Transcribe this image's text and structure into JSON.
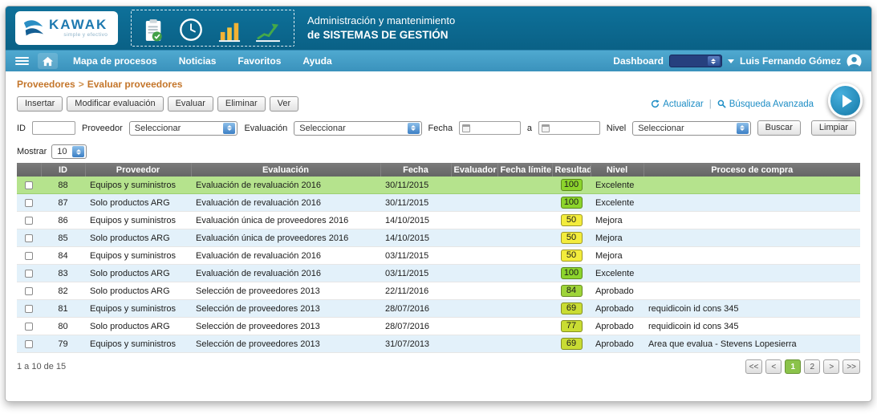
{
  "header": {
    "brand": "KAWAK",
    "tagline": "simple y efectivo",
    "title_line1": "Administración y mantenimiento",
    "title_line2": "de SISTEMAS DE GESTIÓN"
  },
  "nav": {
    "items": [
      "Mapa de procesos",
      "Noticias",
      "Favoritos",
      "Ayuda"
    ],
    "dashboard_label": "Dashboard",
    "dashboard_value": "",
    "user_name": "Luis Fernando Gómez"
  },
  "breadcrumb": {
    "parent": "Proveedores",
    "separator": ">",
    "current": "Evaluar proveedores"
  },
  "toolbar": {
    "buttons": [
      "Insertar",
      "Modificar evaluación",
      "Evaluar",
      "Eliminar",
      "Ver"
    ],
    "refresh_label": "Actualizar",
    "separator": "|",
    "advanced_search_label": "Búsqueda Avanzada"
  },
  "filters": {
    "id_label": "ID",
    "id_value": "",
    "proveedor_label": "Proveedor",
    "evaluacion_label": "Evaluación",
    "fecha_label": "Fecha",
    "fecha_desde": "",
    "fecha_conjunction": "a",
    "fecha_hasta": "",
    "nivel_label": "Nivel",
    "select_value": "Seleccionar",
    "buscar_label": "Buscar",
    "limpiar_label": "Limpiar"
  },
  "list": {
    "mostrar_label": "Mostrar",
    "page_size": "10"
  },
  "table": {
    "headers": [
      "ID",
      "Proveedor",
      "Evaluación",
      "Fecha",
      "Evaluador",
      "Fecha límite",
      "Resultado",
      "Nivel",
      "Proceso de compra"
    ],
    "rows": [
      {
        "id": "88",
        "proveedor": "Equipos y suministros",
        "evaluacion": "Evaluación de revaluación 2016",
        "fecha": "30/11/2015",
        "evaluador": "",
        "fecha_limite": "",
        "resultado": "100",
        "badge_color": "#8CD42C",
        "nivel": "Excelente",
        "proceso_compra": ""
      },
      {
        "id": "87",
        "proveedor": "Solo productos ARG",
        "evaluacion": "Evaluación de revaluación 2016",
        "fecha": "30/11/2015",
        "evaluador": "",
        "fecha_limite": "",
        "resultado": "100",
        "badge_color": "#8CD42C",
        "nivel": "Excelente",
        "proceso_compra": ""
      },
      {
        "id": "86",
        "proveedor": "Equipos y suministros",
        "evaluacion": "Evaluación única de proveedores 2016",
        "fecha": "14/10/2015",
        "evaluador": "",
        "fecha_limite": "",
        "resultado": "50",
        "badge_color": "#F3EC3C",
        "nivel": "Mejora",
        "proceso_compra": ""
      },
      {
        "id": "85",
        "proveedor": "Solo productos ARG",
        "evaluacion": "Evaluación única de proveedores 2016",
        "fecha": "14/10/2015",
        "evaluador": "",
        "fecha_limite": "",
        "resultado": "50",
        "badge_color": "#F3EC3C",
        "nivel": "Mejora",
        "proceso_compra": ""
      },
      {
        "id": "84",
        "proveedor": "Equipos y suministros",
        "evaluacion": "Evaluación de revaluación 2016",
        "fecha": "03/11/2015",
        "evaluador": "",
        "fecha_limite": "",
        "resultado": "50",
        "badge_color": "#F3EC3C",
        "nivel": "Mejora",
        "proceso_compra": ""
      },
      {
        "id": "83",
        "proveedor": "Solo productos ARG",
        "evaluacion": "Evaluación de revaluación 2016",
        "fecha": "03/11/2015",
        "evaluador": "",
        "fecha_limite": "",
        "resultado": "100",
        "badge_color": "#8CD42C",
        "nivel": "Excelente",
        "proceso_compra": ""
      },
      {
        "id": "82",
        "proveedor": "Solo productos ARG",
        "evaluacion": "Selección de proveedores 2013",
        "fecha": "22/11/2016",
        "evaluador": "",
        "fecha_limite": "",
        "resultado": "84",
        "badge_color": "#9ED438",
        "nivel": "Aprobado",
        "proceso_compra": ""
      },
      {
        "id": "81",
        "proveedor": "Equipos y suministros",
        "evaluacion": "Selección de proveedores 2013",
        "fecha": "28/07/2016",
        "evaluador": "",
        "fecha_limite": "",
        "resultado": "69",
        "badge_color": "#C9DC33",
        "nivel": "Aprobado",
        "proceso_compra": "requidicoin id cons 345"
      },
      {
        "id": "80",
        "proveedor": "Solo productos ARG",
        "evaluacion": "Selección de proveedores 2013",
        "fecha": "28/07/2016",
        "evaluador": "",
        "fecha_limite": "",
        "resultado": "77",
        "badge_color": "#C9DC33",
        "nivel": "Aprobado",
        "proceso_compra": "requidicoin id cons 345"
      },
      {
        "id": "79",
        "proveedor": "Equipos y suministros",
        "evaluacion": "Selección de proveedores 2013",
        "fecha": "31/07/2013",
        "evaluador": "",
        "fecha_limite": "",
        "resultado": "69",
        "badge_color": "#C9DC33",
        "nivel": "Aprobado",
        "proceso_compra": "Area que evalua - Stevens Lopesierra"
      }
    ]
  },
  "footer": {
    "count_text": "1 a 10 de 15",
    "pages": [
      "<<",
      "<",
      "1",
      "2",
      ">",
      ">>"
    ],
    "active_page": "1"
  },
  "colors": {
    "header_bg": "#0B6B92",
    "nav_bg": "#3F9EC7",
    "breadcrumb": "#C4762B",
    "link_blue": "#1D8DC5",
    "selected_row": "#B5E38D",
    "zebra_row": "#E3F1FA",
    "badge_green": "#8CD42C",
    "badge_yellow": "#F3EC3C",
    "badge_lime": "#C9DC33",
    "active_page_green": "#8BC34A"
  }
}
